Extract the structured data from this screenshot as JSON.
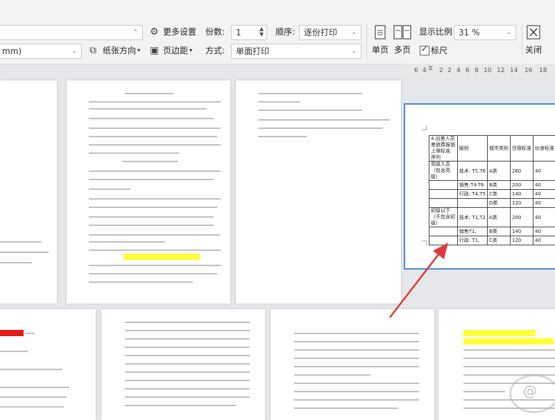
{
  "toolbar": {
    "more_settings": "更多设置",
    "copies_label": "份数:",
    "copies_value": "1",
    "order_label": "顺序:",
    "order_value": "逐份打印",
    "zoom_label": "显示比例",
    "zoom_value": "31 %",
    "paper_size_value": "mm)",
    "orientation_label": "纸张方向",
    "margins_label": "页边距",
    "mode_label": "方式:",
    "mode_value": "单面打印",
    "single_page": "单页",
    "multi_page": "多页",
    "ruler_label": "标尺",
    "ruler_checked": true,
    "close_label": "关闭"
  },
  "ruler": {
    "ticks": [
      "6",
      "4",
      "2",
      "2",
      "4",
      "6",
      "8",
      "10",
      "12",
      "14",
      "16",
      "18"
    ]
  },
  "selected_page": {
    "table": [
      [
        "4.出差人员差旅费报销上限标准.序列",
        "级别",
        "城市类别",
        "住宿标准",
        "伙食标准"
      ],
      [
        "高级人员（包含高级）",
        "技术: T5,T6",
        "A类",
        "260",
        "40"
      ],
      [
        "",
        "销售:T4-T6",
        "B类",
        "200",
        "40"
      ],
      [
        "",
        "行政: T4,T5",
        "C类",
        "140",
        "40"
      ],
      [
        "",
        "",
        "D类",
        "120",
        "40"
      ],
      [
        "初级以下（不包含初级）",
        "技术: T1,T2",
        "A类",
        "200",
        "40"
      ],
      [
        "",
        "销售T1,",
        "B类",
        "140",
        "40"
      ],
      [
        "",
        "行政: T1,",
        "C类",
        "120",
        "40"
      ]
    ]
  },
  "colors": {
    "accent": "#4a86d8",
    "arrow": "#e03a3a",
    "highlight": "#ffff3a"
  }
}
